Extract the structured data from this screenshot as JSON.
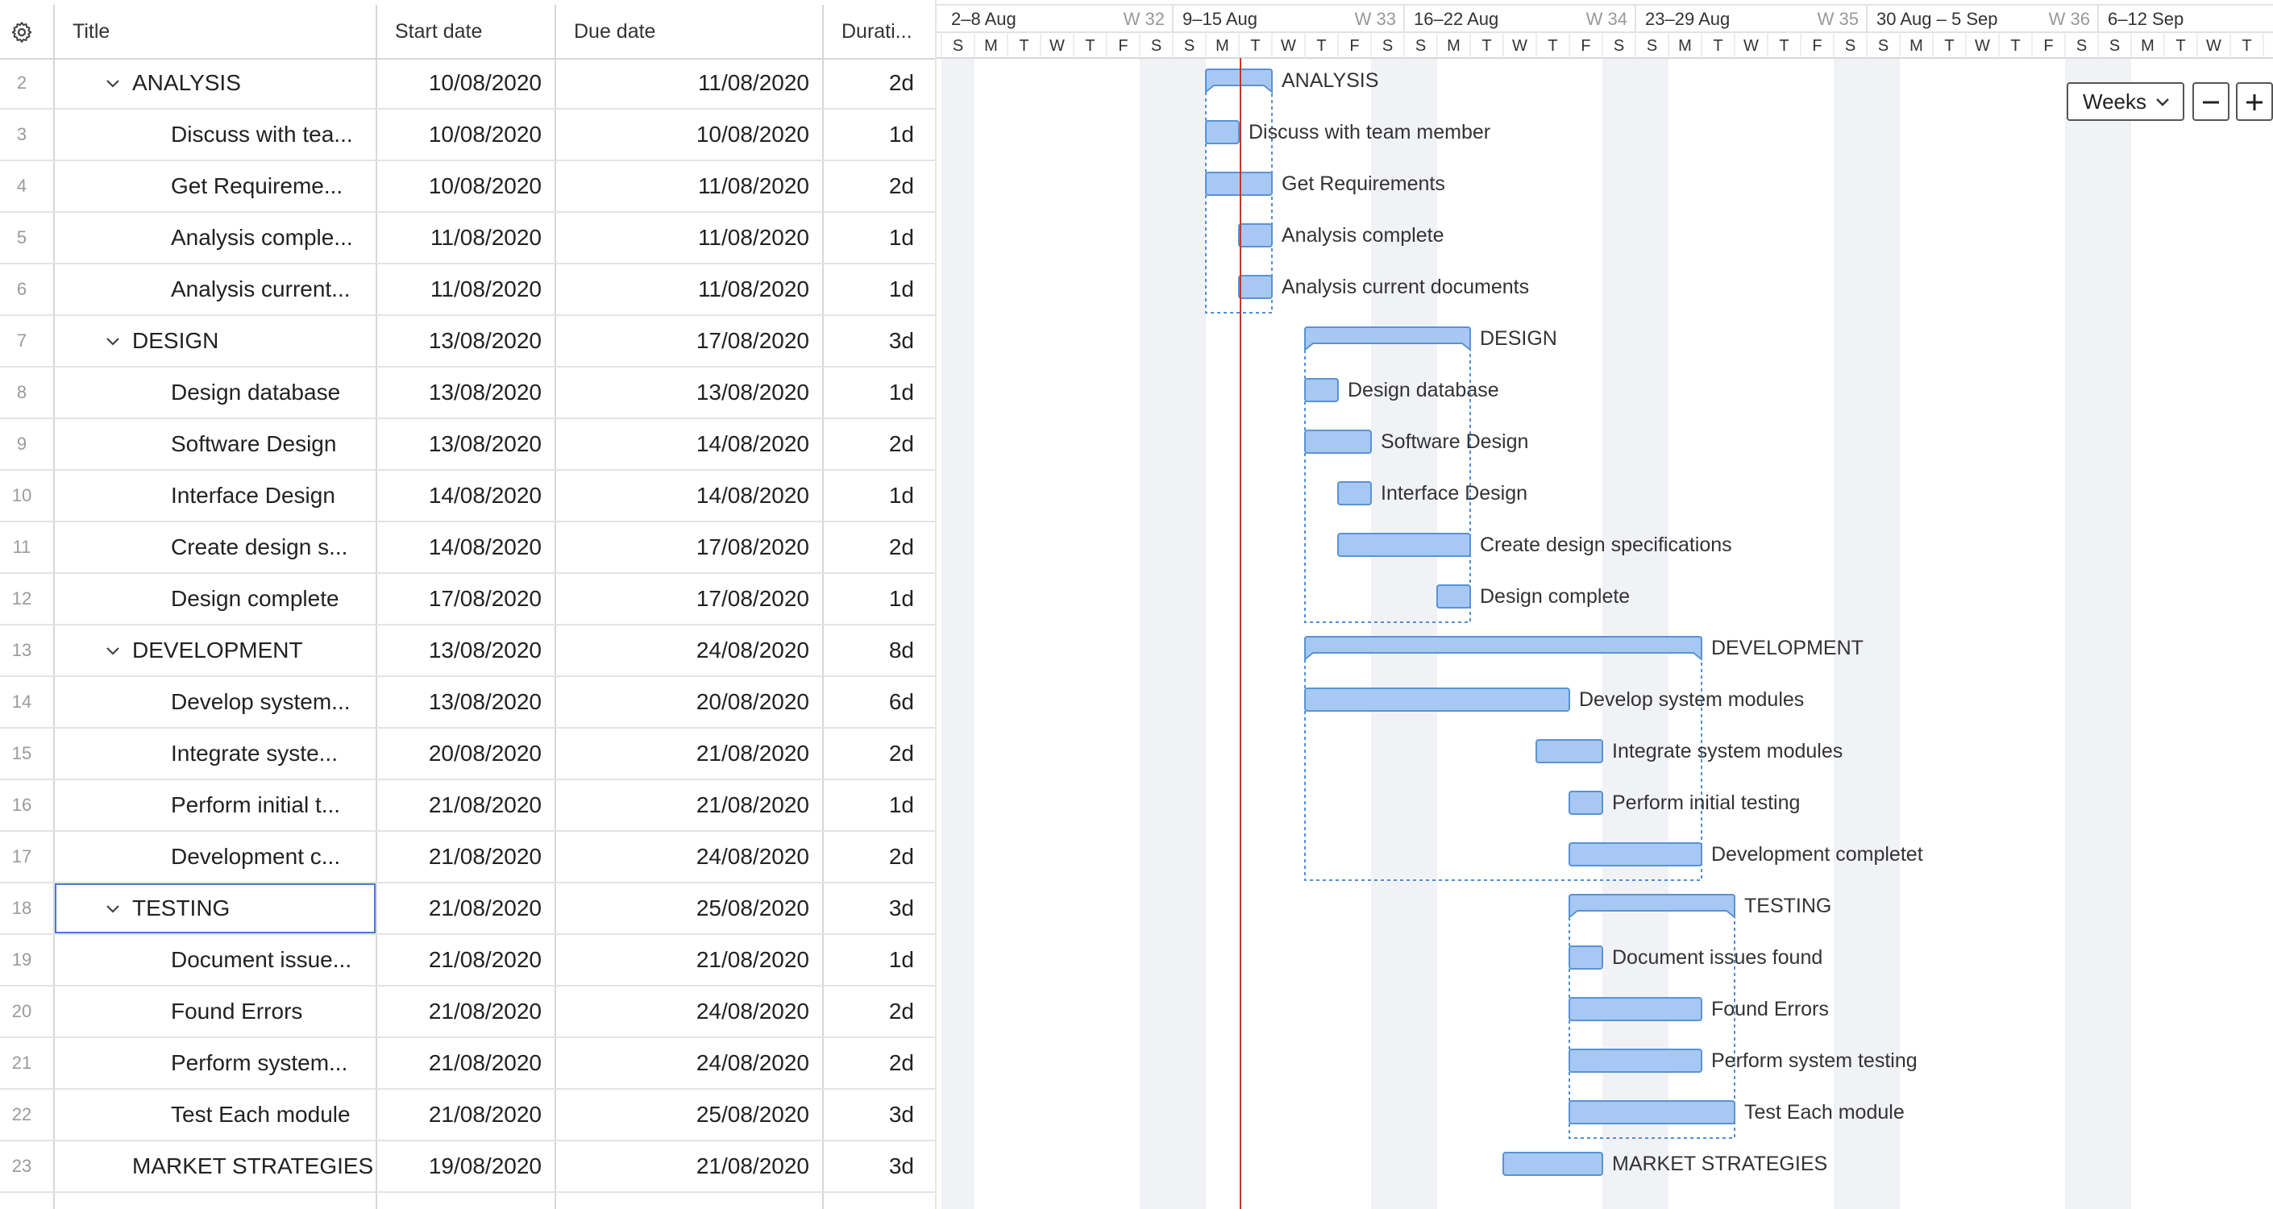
{
  "grid": {
    "columns": {
      "settings_icon": "gear-icon",
      "title": "Title",
      "start": "Start date",
      "due": "Due date",
      "duration": "Durati..."
    },
    "rows": [
      {
        "num": "2",
        "title": "ANALYSIS",
        "start": "10/08/2020",
        "due": "11/08/2020",
        "duration": "2d",
        "type": "group",
        "expanded": true
      },
      {
        "num": "3",
        "title": "Discuss with tea...",
        "start": "10/08/2020",
        "due": "10/08/2020",
        "duration": "1d",
        "type": "task"
      },
      {
        "num": "4",
        "title": "Get Requireme...",
        "start": "10/08/2020",
        "due": "11/08/2020",
        "duration": "2d",
        "type": "task"
      },
      {
        "num": "5",
        "title": "Analysis comple...",
        "start": "11/08/2020",
        "due": "11/08/2020",
        "duration": "1d",
        "type": "task"
      },
      {
        "num": "6",
        "title": "Analysis current...",
        "start": "11/08/2020",
        "due": "11/08/2020",
        "duration": "1d",
        "type": "task"
      },
      {
        "num": "7",
        "title": "DESIGN",
        "start": "13/08/2020",
        "due": "17/08/2020",
        "duration": "3d",
        "type": "group",
        "expanded": true
      },
      {
        "num": "8",
        "title": "Design database",
        "start": "13/08/2020",
        "due": "13/08/2020",
        "duration": "1d",
        "type": "task"
      },
      {
        "num": "9",
        "title": "Software Design",
        "start": "13/08/2020",
        "due": "14/08/2020",
        "duration": "2d",
        "type": "task"
      },
      {
        "num": "10",
        "title": "Interface Design",
        "start": "14/08/2020",
        "due": "14/08/2020",
        "duration": "1d",
        "type": "task"
      },
      {
        "num": "11",
        "title": "Create design s...",
        "start": "14/08/2020",
        "due": "17/08/2020",
        "duration": "2d",
        "type": "task"
      },
      {
        "num": "12",
        "title": "Design complete",
        "start": "17/08/2020",
        "due": "17/08/2020",
        "duration": "1d",
        "type": "task"
      },
      {
        "num": "13",
        "title": "DEVELOPMENT",
        "start": "13/08/2020",
        "due": "24/08/2020",
        "duration": "8d",
        "type": "group",
        "expanded": true
      },
      {
        "num": "14",
        "title": "Develop system...",
        "start": "13/08/2020",
        "due": "20/08/2020",
        "duration": "6d",
        "type": "task"
      },
      {
        "num": "15",
        "title": "Integrate syste...",
        "start": "20/08/2020",
        "due": "21/08/2020",
        "duration": "2d",
        "type": "task"
      },
      {
        "num": "16",
        "title": "Perform initial t...",
        "start": "21/08/2020",
        "due": "21/08/2020",
        "duration": "1d",
        "type": "task"
      },
      {
        "num": "17",
        "title": "Development c...",
        "start": "21/08/2020",
        "due": "24/08/2020",
        "duration": "2d",
        "type": "task"
      },
      {
        "num": "18",
        "title": "TESTING",
        "start": "21/08/2020",
        "due": "25/08/2020",
        "duration": "3d",
        "type": "group",
        "expanded": true,
        "selected": true
      },
      {
        "num": "19",
        "title": "Document issue...",
        "start": "21/08/2020",
        "due": "21/08/2020",
        "duration": "1d",
        "type": "task"
      },
      {
        "num": "20",
        "title": "Found Errors",
        "start": "21/08/2020",
        "due": "24/08/2020",
        "duration": "2d",
        "type": "task"
      },
      {
        "num": "21",
        "title": "Perform system...",
        "start": "21/08/2020",
        "due": "24/08/2020",
        "duration": "2d",
        "type": "task"
      },
      {
        "num": "22",
        "title": "Test Each module",
        "start": "21/08/2020",
        "due": "25/08/2020",
        "duration": "3d",
        "type": "task"
      },
      {
        "num": "23",
        "title": "MARKET STRATEGIES",
        "start": "19/08/2020",
        "due": "21/08/2020",
        "duration": "3d",
        "type": "group_leaf"
      }
    ]
  },
  "timeline": {
    "weeks": [
      {
        "range": "2–8 Aug",
        "week": "W 32"
      },
      {
        "range": "9–15 Aug",
        "week": "W 33"
      },
      {
        "range": "16–22 Aug",
        "week": "W 34"
      },
      {
        "range": "23–29 Aug",
        "week": "W 35"
      },
      {
        "range": "30 Aug – 5 Sep",
        "week": "W 36"
      },
      {
        "range": "6–12 Sep",
        "week": ""
      }
    ],
    "day_letters": [
      "S",
      "M",
      "T",
      "W",
      "T",
      "F",
      "S"
    ],
    "first_day": "2020-08-02",
    "today": "2020-08-11",
    "bar_labels": [
      "ANALYSIS",
      "Discuss with team member",
      "Get Requirements",
      "Analysis complete",
      "Analysis current documents",
      "DESIGN",
      "Design database",
      "Software Design",
      "Interface Design",
      "Create design specifications",
      "Design complete",
      "DEVELOPMENT",
      "Develop system modules",
      "Integrate system modules",
      "Perform initial testing",
      "Development completet",
      "TESTING",
      "Document issues found",
      "Found Errors",
      "Perform system testing",
      "Test Each module",
      "MARKET STRATEGIES"
    ]
  },
  "controls": {
    "scale_value": "Weeks",
    "scale_icon": "chevron-down-icon",
    "zoom_out_icon": "minus-icon",
    "zoom_in_icon": "plus-icon"
  },
  "colors": {
    "bar_fill": "#a7c8f2",
    "bar_stroke": "#5a93d6",
    "today_line": "#c0392b",
    "weekend_shade": "#f1f2f6",
    "group_outline": "#4f8fd6"
  }
}
